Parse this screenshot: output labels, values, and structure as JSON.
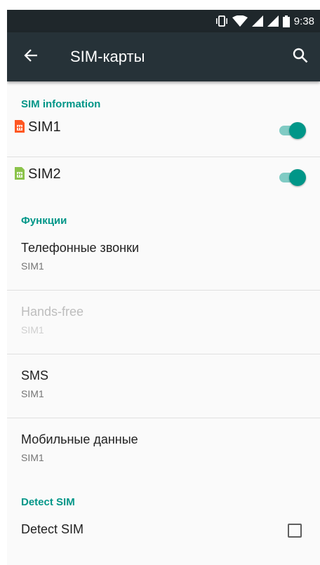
{
  "status": {
    "time": "9:38",
    "icons": [
      "vibrate-icon",
      "wifi-icon",
      "signal-icon",
      "signal-icon",
      "battery-icon"
    ]
  },
  "toolbar": {
    "title": "SIM-карты",
    "back_icon": "arrow-back-icon",
    "search_icon": "search-icon"
  },
  "sim_section": {
    "header": "SIM information",
    "items": [
      {
        "label": "SIM1",
        "color": "#ff5722",
        "enabled": true
      },
      {
        "label": "SIM2",
        "color": "#8bc34a",
        "enabled": true
      }
    ]
  },
  "functions_section": {
    "header": "Функции",
    "items": [
      {
        "title": "Телефонные звонки",
        "subtitle": "SIM1",
        "enabled": true
      },
      {
        "title": "Hands-free",
        "subtitle": "SIM1",
        "enabled": false
      },
      {
        "title": "SMS",
        "subtitle": "SIM1",
        "enabled": true
      },
      {
        "title": "Мобильные данные",
        "subtitle": "SIM1",
        "enabled": true
      }
    ]
  },
  "detect_section": {
    "header": "Detect SIM",
    "item_label": "Detect SIM",
    "checked": false
  },
  "colors": {
    "accent": "#009688",
    "toolbar": "#263238",
    "statusbar": "#1f272b"
  }
}
